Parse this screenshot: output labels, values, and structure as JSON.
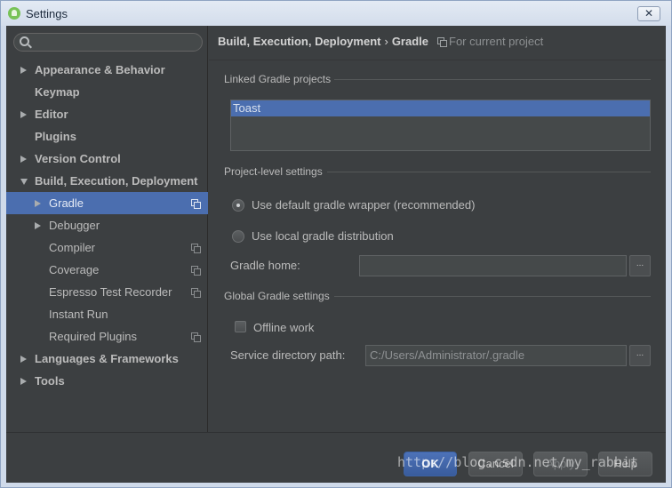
{
  "window": {
    "title": "Settings",
    "close_label": "✕"
  },
  "sidebar": {
    "search": {
      "value": "",
      "placeholder": ""
    },
    "items": [
      {
        "label": "Appearance & Behavior",
        "arrow": "right",
        "top": true
      },
      {
        "label": "Keymap",
        "arrow": "",
        "top": true
      },
      {
        "label": "Editor",
        "arrow": "right",
        "top": true
      },
      {
        "label": "Plugins",
        "arrow": "",
        "top": true
      },
      {
        "label": "Version Control",
        "arrow": "right",
        "top": true
      },
      {
        "label": "Build, Execution, Deployment",
        "arrow": "down",
        "top": true
      },
      {
        "label": "Gradle",
        "arrow": "right",
        "top": false,
        "selected": true,
        "project_icon": true
      },
      {
        "label": "Debugger",
        "arrow": "right",
        "top": false
      },
      {
        "label": "Compiler",
        "arrow": "",
        "top": false,
        "project_icon": true
      },
      {
        "label": "Coverage",
        "arrow": "",
        "top": false,
        "project_icon": true
      },
      {
        "label": "Espresso Test Recorder",
        "arrow": "",
        "top": false,
        "project_icon": true
      },
      {
        "label": "Instant Run",
        "arrow": "",
        "top": false
      },
      {
        "label": "Required Plugins",
        "arrow": "",
        "top": false,
        "project_icon": true
      },
      {
        "label": "Languages & Frameworks",
        "arrow": "right",
        "top": true
      },
      {
        "label": "Tools",
        "arrow": "right",
        "top": true
      }
    ]
  },
  "main": {
    "breadcrumb": {
      "parent": "Build, Execution, Deployment",
      "separator": "›",
      "current": "Gradle",
      "scope": "For current project"
    },
    "linked_section": "Linked Gradle projects",
    "linked_projects": [
      "Toast"
    ],
    "project_section": "Project-level settings",
    "option_default": "Use default gradle wrapper (recommended)",
    "option_local": "Use local gradle distribution",
    "selected_option": "default",
    "gradle_home_label": "Gradle home:",
    "gradle_home_value": "",
    "browse_label": "...",
    "global_section": "Global Gradle settings",
    "offline_label": "Offline work",
    "offline_checked": false,
    "service_dir_label": "Service directory path:",
    "service_dir_value": "C:/Users/Administrator/.gradle"
  },
  "footer": {
    "ok": "OK",
    "cancel": "Cancel",
    "apply": "Apply",
    "help": "Help"
  },
  "watermark": "http://blog.csdn.net/my_rabbit"
}
